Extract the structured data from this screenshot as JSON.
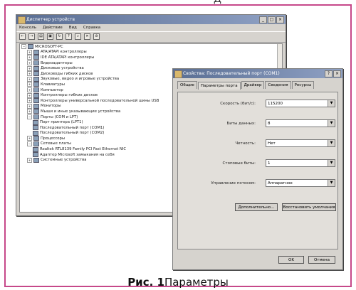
{
  "page_top_text": "Д",
  "device_manager": {
    "title": "Диспетчер устройств",
    "menu": [
      "Консоль",
      "Действие",
      "Вид",
      "Справка"
    ],
    "toolbar_icons": [
      "back-icon",
      "forward-icon",
      "view-icon",
      "properties-icon",
      "refresh-icon",
      "help-icon",
      "scan-icon",
      "remove-icon",
      "disable-icon"
    ],
    "tree": [
      {
        "label": "MICROSOFT-PC",
        "level": 0,
        "expanded": true
      },
      {
        "label": "ATA/ATAPI контроллеры",
        "level": 1
      },
      {
        "label": "IDE ATA/ATAPI контроллеры",
        "level": 1
      },
      {
        "label": "Видеоадаптеры",
        "level": 1
      },
      {
        "label": "Дисковые устройства",
        "level": 1
      },
      {
        "label": "Дисководы гибких дисков",
        "level": 1
      },
      {
        "label": "Звуковые, видео и игровые устройства",
        "level": 1
      },
      {
        "label": "Клавиатуры",
        "level": 1
      },
      {
        "label": "Компьютер",
        "level": 1
      },
      {
        "label": "Контроллеры гибких дисков",
        "level": 1
      },
      {
        "label": "Контроллеры универсальной последовательной шины USB",
        "level": 1
      },
      {
        "label": "Мониторы",
        "level": 1
      },
      {
        "label": "Мыши и иные указывающие устройства",
        "level": 1
      },
      {
        "label": "Порты (COM и LPT)",
        "level": 1,
        "expanded": true
      },
      {
        "label": "Порт принтера (LPT1)",
        "level": 2
      },
      {
        "label": "Последовательный порт (COM1)",
        "level": 2
      },
      {
        "label": "Последовательный порт (COM2)",
        "level": 2
      },
      {
        "label": "Процессоры",
        "level": 1
      },
      {
        "label": "Сетевые платы",
        "level": 1,
        "expanded": true
      },
      {
        "label": "Realtek RTL8139 Family PCI Fast Ethernet NIC",
        "level": 2
      },
      {
        "label": "Адаптер Microsoft замыкания на себя",
        "level": 2
      },
      {
        "label": "Системные устройства",
        "level": 1
      }
    ]
  },
  "port_dialog": {
    "title": "Свойства: Последовательный порт (COM1)",
    "tabs": [
      "Общие",
      "Параметры порта",
      "Драйвер",
      "Сведения",
      "Ресурсы"
    ],
    "active_tab": 1,
    "fields": [
      {
        "label": "Скорость (бит/с):",
        "value": "115200"
      },
      {
        "label": "Биты данных:",
        "value": "8"
      },
      {
        "label": "Четность:",
        "value": "Нет"
      },
      {
        "label": "Стоповые биты:",
        "value": "1"
      },
      {
        "label": "Управление потоком:",
        "value": "Аппаратное"
      }
    ],
    "buttons": {
      "advanced": "Дополнительно...",
      "restore": "Восстановить умолчания",
      "ok": "OK",
      "cancel": "Отмена"
    }
  },
  "caption": {
    "bold": "Рис. 1",
    "rest": "Параметры"
  }
}
